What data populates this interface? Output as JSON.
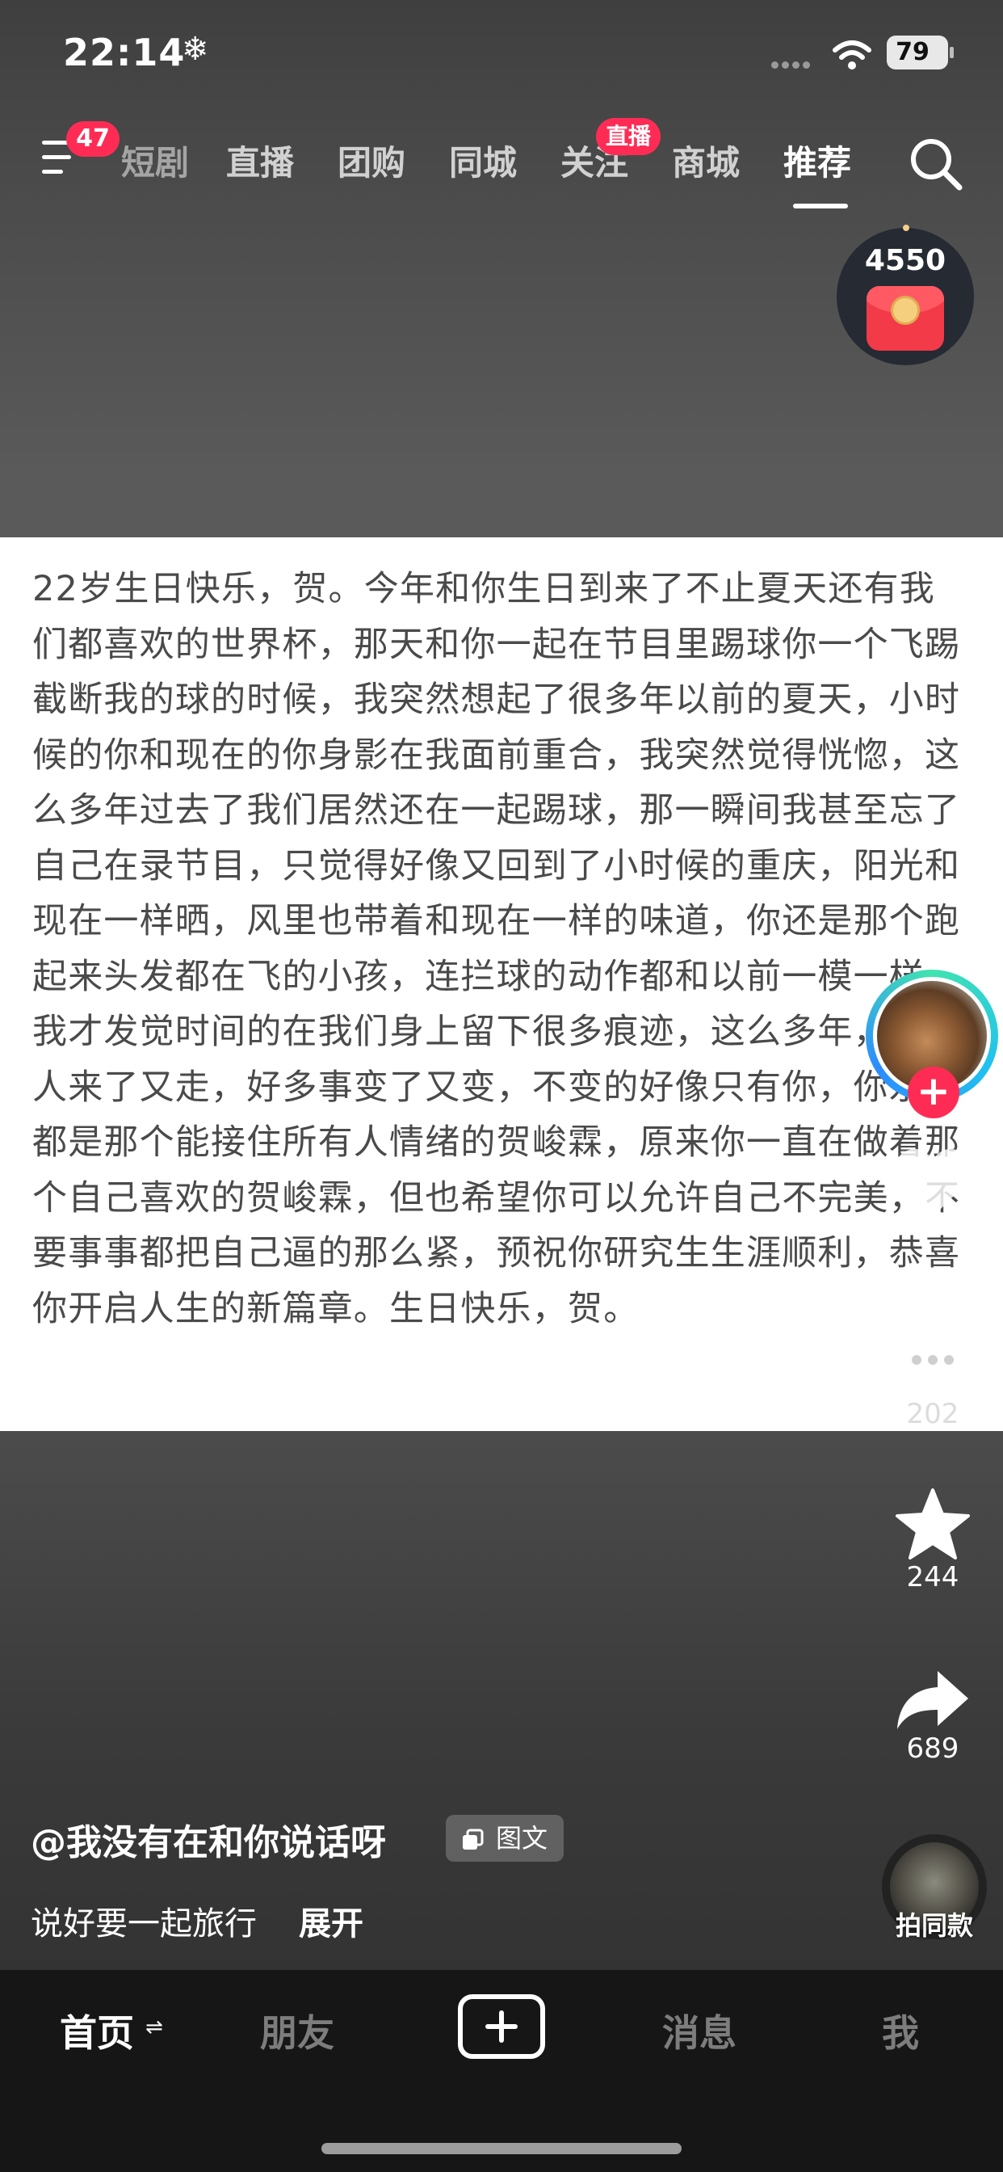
{
  "status_bar": {
    "time": "22:14",
    "weather_glyph": "❄",
    "battery": "79"
  },
  "top_nav": {
    "menu_badge": "47",
    "tabs": [
      "短剧",
      "直播",
      "团购",
      "同城",
      "关注",
      "商城",
      "推荐"
    ],
    "active_tab": "推荐",
    "live_badge": "直播"
  },
  "red_packet": {
    "amount": "4550"
  },
  "post": {
    "body": "22岁生日快乐，贺。今年和你生日到来了不止夏天还有我们都喜欢的世界杯，那天和你一起在节目里踢球你一个飞踢截断我的球的时候，我突然想起了很多年以前的夏天，小时候的你和现在的你身影在我面前重合，我突然觉得恍惚，这么多年过去了我们居然还在一起踢球，那一瞬间我甚至忘了自己在录节目，只觉得好像又回到了小时候的重庆，阳光和现在一样晒，风里也带着和现在一样的味道，你还是那个跑起来头发都在飞的小孩，连拦球的动作都和以前一模一样，我才发觉时间的在我们身上留下很多痕迹，这么多年，好多人来了又走，好多事变了又变，不变的好像只有你，你永远都是那个能接住所有人情绪的贺峻霖，原来你一直在做着那个自己喜欢的贺峻霖，但也希望你可以允许自己不完美，不要事事都把自己逼的那么紧，预祝你研究生生涯顺利，恭喜你开启人生的新篇章。生日快乐，贺。",
    "author": "@我没有在和你说话呀",
    "type_label": "图文",
    "description": "说好要一起旅行",
    "expand_label": "展开"
  },
  "actions": {
    "comments": "202",
    "favorites": "244",
    "shares": "689",
    "music_label": "拍同款"
  },
  "bottom_nav": {
    "home": "首页",
    "friends": "朋友",
    "messages": "消息",
    "me": "我"
  },
  "colors": {
    "accent_red": "#fe2c55",
    "nav_background": "#161616",
    "card_background": "#ffffff",
    "card_text": "#4a4a4a"
  },
  "icons": [
    "menu-icon",
    "search-icon",
    "wifi-icon",
    "heart-icon",
    "comment-icon",
    "star-icon",
    "share-icon",
    "add-icon",
    "image-text-icon"
  ]
}
